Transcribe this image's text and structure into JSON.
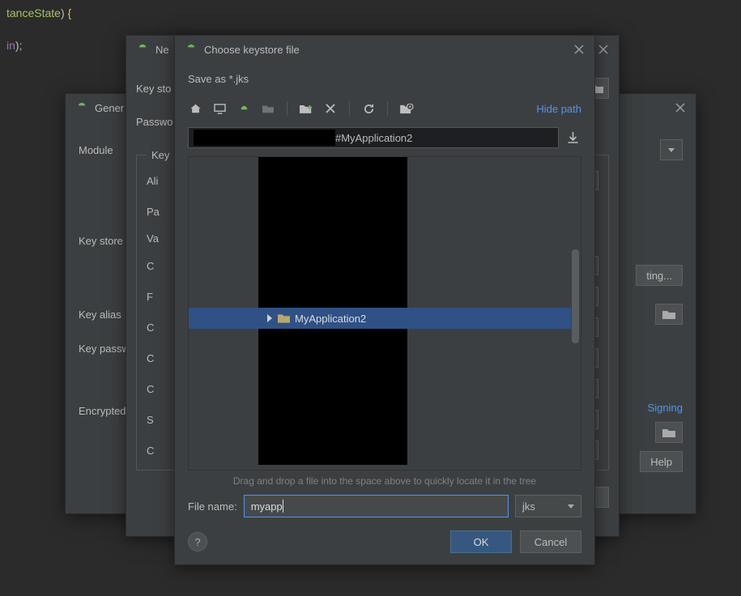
{
  "code": {
    "l1_ident": "tanceState",
    "l1_paren": ")",
    "l1_brace": " {",
    "l2_ident": "in",
    "l2_paren": ")",
    "l2_semi": ";"
  },
  "gener": {
    "title": "Gener",
    "module_label": "Module",
    "keystore_label": "Key store",
    "keyalias_label": "Key alias",
    "keypass_label": "Key passw",
    "encrypted_label": "Encrypted",
    "existing_btn": "ting...",
    "signing_link": "Signing",
    "help_btn": "Help"
  },
  "newks": {
    "title": "Ne",
    "keystore_lbl": "Key sto",
    "password_lbl": "Passwo",
    "key_legend": "Key",
    "alias_lbl": "Ali",
    "pass_lbl": "Pa",
    "valid_lbl": "Va",
    "cert_rows": [
      "C",
      "F",
      "C",
      "C",
      "C",
      "S",
      "C"
    ]
  },
  "chooser": {
    "title": "Choose keystore file",
    "subtitle": "Save as *.jks",
    "hide_path": "Hide path",
    "path_suffix": "#MyApplication2",
    "selected_folder": "MyApplication2",
    "hint": "Drag and drop a file into the space above to quickly locate it in the tree",
    "filename_label": "File name:",
    "filename_value": "myapp",
    "ext_value": "jks",
    "ok": "OK",
    "cancel": "Cancel",
    "help": "?"
  },
  "icons": {
    "android": "android-icon",
    "home": "home-icon",
    "desktop": "desktop-icon",
    "project": "project-icon",
    "module": "module-icon",
    "newfolder": "new-folder-icon",
    "delete": "delete-icon",
    "refresh": "refresh-icon",
    "showhidden": "show-hidden-icon",
    "save": "save-icon",
    "folder": "folder-icon",
    "triangle": "expand-icon"
  },
  "colors": {
    "bg": "#3c3f41",
    "accent": "#5394ec",
    "selection": "#2f5185",
    "primary_btn": "#365880"
  }
}
